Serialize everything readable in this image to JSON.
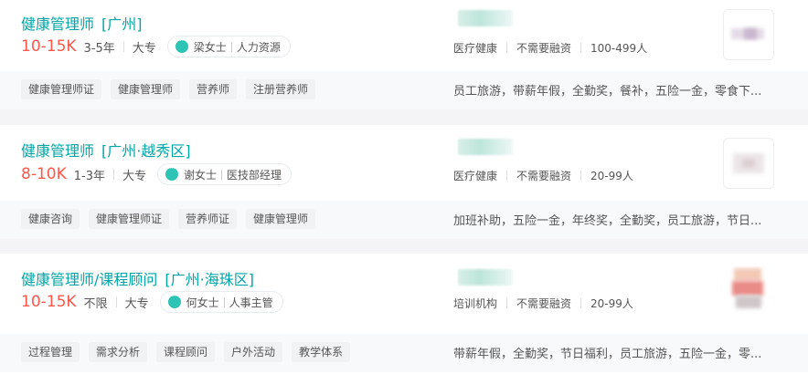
{
  "jobs": [
    {
      "title": "健康管理师",
      "location": "[广州]",
      "salary": "10-15K",
      "experience": "3-5年",
      "education": "大专",
      "contact_name": "梁女士",
      "contact_role": "人力资源",
      "industry": "医疗健康",
      "funding": "不需要融资",
      "size": "100-499人",
      "tags": [
        "健康管理师证",
        "健康管理师",
        "营养师",
        "注册营养师"
      ],
      "welfare": "员工旅游，带薪年假，全勤奖，餐补，五险一金，零食下..."
    },
    {
      "title": "健康管理师",
      "location": "[广州·越秀区]",
      "salary": "8-10K",
      "experience": "1-3年",
      "education": "大专",
      "contact_name": "谢女士",
      "contact_role": "医技部经理",
      "industry": "医疗健康",
      "funding": "不需要融资",
      "size": "20-99人",
      "tags": [
        "健康咨询",
        "健康管理师证",
        "营养师证",
        "健康管理师"
      ],
      "welfare": "加班补助，五险一金，年终奖，全勤奖，员工旅游，节日..."
    },
    {
      "title": "健康管理师/课程顾问",
      "location": "[广州·海珠区]",
      "salary": "10-15K",
      "experience": "不限",
      "education": "大专",
      "contact_name": "何女士",
      "contact_role": "人事主管",
      "industry": "培训机构",
      "funding": "不需要融资",
      "size": "20-99人",
      "tags": [
        "过程管理",
        "需求分析",
        "课程顾问",
        "户外活动",
        "教学体系"
      ],
      "welfare": "带薪年假，全勤奖，节日福利，员工旅游，五险一金，零..."
    }
  ],
  "icons": {
    "chat": "chat-bubble-icon"
  },
  "colors": {
    "title": "#00a6a7",
    "salary": "#fe574a",
    "chat": "#2dc4b6"
  }
}
